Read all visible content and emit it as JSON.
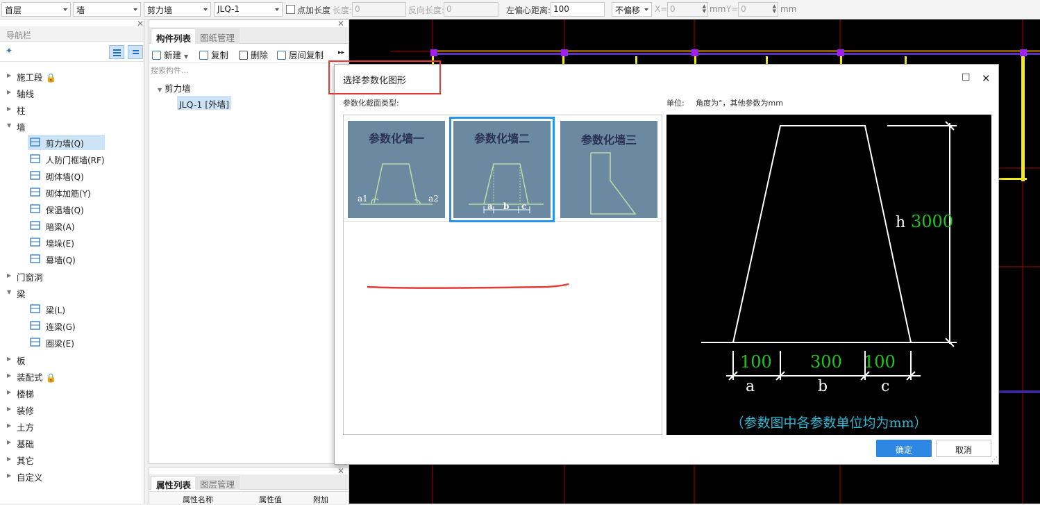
{
  "toolbar": {
    "floor": "首层",
    "category": "墙",
    "type": "剪力墙",
    "component": "JLQ-1",
    "add_length_label": "点加长度",
    "length_label": "长度:",
    "length_value": "0",
    "reverse_length_label": "反向长度:",
    "reverse_length_value": "0",
    "left_offset_label": "左偏心距离:",
    "left_offset_value": "100",
    "offset_mode": "不偏移",
    "x_label": "X=",
    "x_value": "0",
    "mm1": "mm",
    "y_label": "Y=",
    "y_value": "0",
    "mm2": "mm"
  },
  "nav": {
    "title": "导航栏",
    "items": [
      {
        "label": "施工段 🔒"
      },
      {
        "label": "轴线"
      },
      {
        "label": "柱"
      },
      {
        "label": "墙"
      },
      {
        "label": "门窗洞"
      },
      {
        "label": "梁"
      },
      {
        "label": "板"
      },
      {
        "label": "装配式 🔒"
      },
      {
        "label": "楼梯"
      },
      {
        "label": "装修"
      },
      {
        "label": "土方"
      },
      {
        "label": "基础"
      },
      {
        "label": "其它"
      },
      {
        "label": "自定义"
      }
    ],
    "wall_children": [
      {
        "label": "剪力墙(Q)"
      },
      {
        "label": "人防门框墙(RF)"
      },
      {
        "label": "砌体墙(Q)"
      },
      {
        "label": "砌体加筋(Y)"
      },
      {
        "label": "保温墙(Q)"
      },
      {
        "label": "暗梁(A)"
      },
      {
        "label": "墙垛(E)"
      },
      {
        "label": "幕墙(Q)"
      }
    ],
    "beam_children": [
      {
        "label": "梁(L)"
      },
      {
        "label": "连梁(G)"
      },
      {
        "label": "圈梁(E)"
      }
    ]
  },
  "components": {
    "tab_active": "构件列表",
    "tab_other": "图纸管理",
    "new": "新建",
    "copy": "复制",
    "delete": "删除",
    "layer_copy": "层间复制",
    "search_placeholder": "搜索构件...",
    "tree_parent": "剪力墙",
    "tree_child": "JLQ-1 [外墙]"
  },
  "properties": {
    "tab_active": "属性列表",
    "tab_other": "图层管理",
    "col_name": "属性名称",
    "col_value": "属性值",
    "col_add": "附加"
  },
  "dialog": {
    "title": "选择参数化图形",
    "section_type_label": "参数化截面类型:",
    "unit_label": "单位:",
    "unit_desc": "角度为°，其他参数为mm",
    "shapes": [
      {
        "name": "参数化墙一",
        "param1": "a1",
        "param2": "a2"
      },
      {
        "name": "参数化墙二",
        "pa": "a",
        "pb": "b",
        "pc": "c"
      },
      {
        "name": "参数化墙三"
      }
    ],
    "selected_shape": 1,
    "preview": {
      "h_label": "h",
      "h_value": "3000",
      "a_label": "a",
      "a_value": "100",
      "b_label": "b",
      "b_value": "300",
      "c_label": "c",
      "c_value": "100",
      "note": "（参数图中各参数单位均为mm）"
    },
    "ok": "确定",
    "cancel": "取消"
  },
  "colors": {
    "accent": "#2d87e3",
    "highlight_red": "#e53935",
    "preview_value_green": "#22c51e",
    "preview_note_cyan": "#2bb8d6"
  }
}
